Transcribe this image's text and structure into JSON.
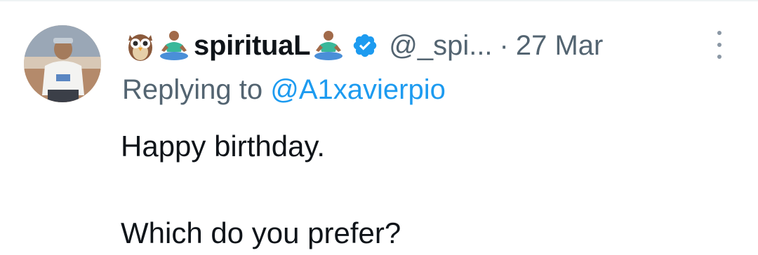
{
  "tweet": {
    "display_name": "spirituaL",
    "handle": "@_spi...",
    "separator": "·",
    "timestamp": "27 Mar",
    "verified": true,
    "emojis_before_name": [
      "owl-emoji",
      "meditating-person-emoji"
    ],
    "emojis_after_name": [
      "meditating-person-emoji"
    ],
    "replying_label": "Replying to",
    "replying_to": "@A1xavierpio",
    "lines": [
      "Happy birthday.",
      "Which do you prefer?"
    ]
  },
  "colors": {
    "primary_text": "#0f1419",
    "secondary_text": "#536471",
    "accent": "#1d9bf0",
    "divider": "#eff3f4"
  }
}
